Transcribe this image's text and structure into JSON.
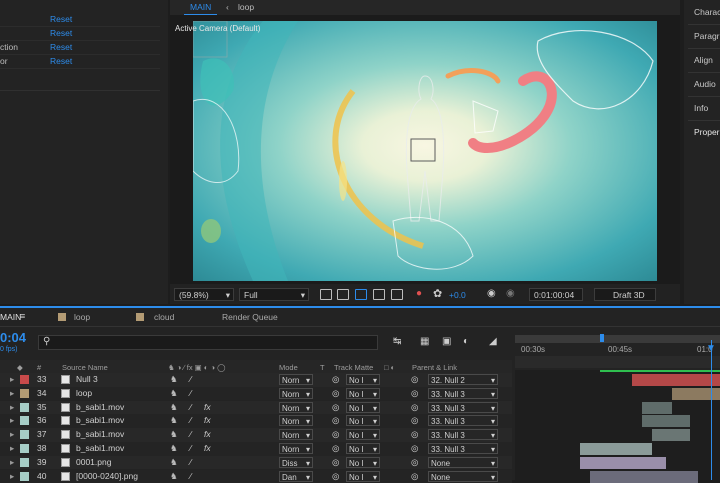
{
  "effect_controls": {
    "rows": [
      {
        "name": "",
        "reset": "Reset"
      },
      {
        "name": "",
        "reset": "Reset"
      },
      {
        "name": "ction",
        "reset": "Reset"
      },
      {
        "name": "or",
        "reset": "Reset"
      }
    ]
  },
  "viewer": {
    "tabs": [
      "MAIN",
      "loop"
    ],
    "canvas_label": "Active Camera (Default)",
    "zoom": "(59.8%)",
    "resolution": "Full",
    "exposure": "+0.0",
    "timecode": "0:01:00:04",
    "renderer": "Draft 3D"
  },
  "right_panel": {
    "items": [
      "Charac",
      "Paragr",
      "Align",
      "Audio",
      "Info",
      "Proper"
    ]
  },
  "timeline": {
    "tabs": [
      "MAIN",
      "loop",
      "cloud",
      "Render Queue"
    ],
    "tab_colors": [
      "#3b6fb0",
      "#b39b74",
      "#b39b74",
      ""
    ],
    "timecode": "0:04",
    "fps": "0 fps)",
    "headers": {
      "num": "#",
      "source_name": "Source Name",
      "mode": "Mode",
      "t": "T",
      "track_matte": "Track Matte",
      "parent_link": "Parent & Link"
    },
    "ruler": [
      "00:30s",
      "00:45s",
      "01:0"
    ],
    "layers": [
      {
        "num": "33",
        "color": "#c84a4a",
        "name": "Null 3",
        "mode": "Norn",
        "matte": "No I",
        "parent": "32. Null 2",
        "fx": false
      },
      {
        "num": "34",
        "color": "#b39b74",
        "name": "loop",
        "mode": "Norn",
        "matte": "No I",
        "parent": "33. Null 3",
        "fx": false
      },
      {
        "num": "35",
        "color": "#a6cdc6",
        "name": "b_sabi1.mov",
        "mode": "Norn",
        "matte": "No I",
        "parent": "33. Null 3",
        "fx": true
      },
      {
        "num": "36",
        "color": "#a6cdc6",
        "name": "b_sabi1.mov",
        "mode": "Norn",
        "matte": "No I",
        "parent": "33. Null 3",
        "fx": true
      },
      {
        "num": "37",
        "color": "#a6cdc6",
        "name": "b_sabi1.mov",
        "mode": "Norn",
        "matte": "No I",
        "parent": "33. Null 3",
        "fx": true
      },
      {
        "num": "38",
        "color": "#a6cdc6",
        "name": "b_sabi1.mov",
        "mode": "Norn",
        "matte": "No I",
        "parent": "33. Null 3",
        "fx": true
      },
      {
        "num": "39",
        "color": "#a6cdc6",
        "name": "0001.png",
        "mode": "Diss",
        "matte": "No I",
        "parent": "None",
        "fx": false
      },
      {
        "num": "40",
        "color": "#a6cdc6",
        "name": "[0000-0240].png",
        "mode": "Dan",
        "matte": "No I",
        "parent": "None",
        "fx": false
      }
    ]
  },
  "colors": {
    "accent": "#2d8ceb",
    "canvas_sky": "#2a8f9a",
    "canvas_glow": "#f4f2d8"
  }
}
